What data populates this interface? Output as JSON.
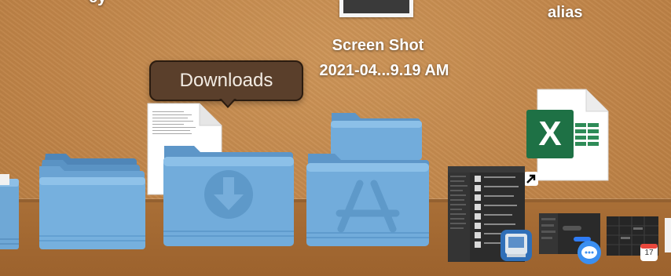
{
  "desktop": {
    "alias_label": "alias",
    "top_left_label": "ey",
    "screenshot_label_line1": "Screen Shot",
    "screenshot_label_line2": "2021-04...9.19 AM"
  },
  "tooltip": {
    "text": "Downloads"
  },
  "dock": {
    "excel_letter": "X",
    "calendar_day": "17",
    "colors": {
      "folder_blue": "#6fa8d6",
      "excel_green": "#1e7145",
      "shelf": "#a46a33",
      "tooltip_bg": "#5a3f2b"
    }
  }
}
